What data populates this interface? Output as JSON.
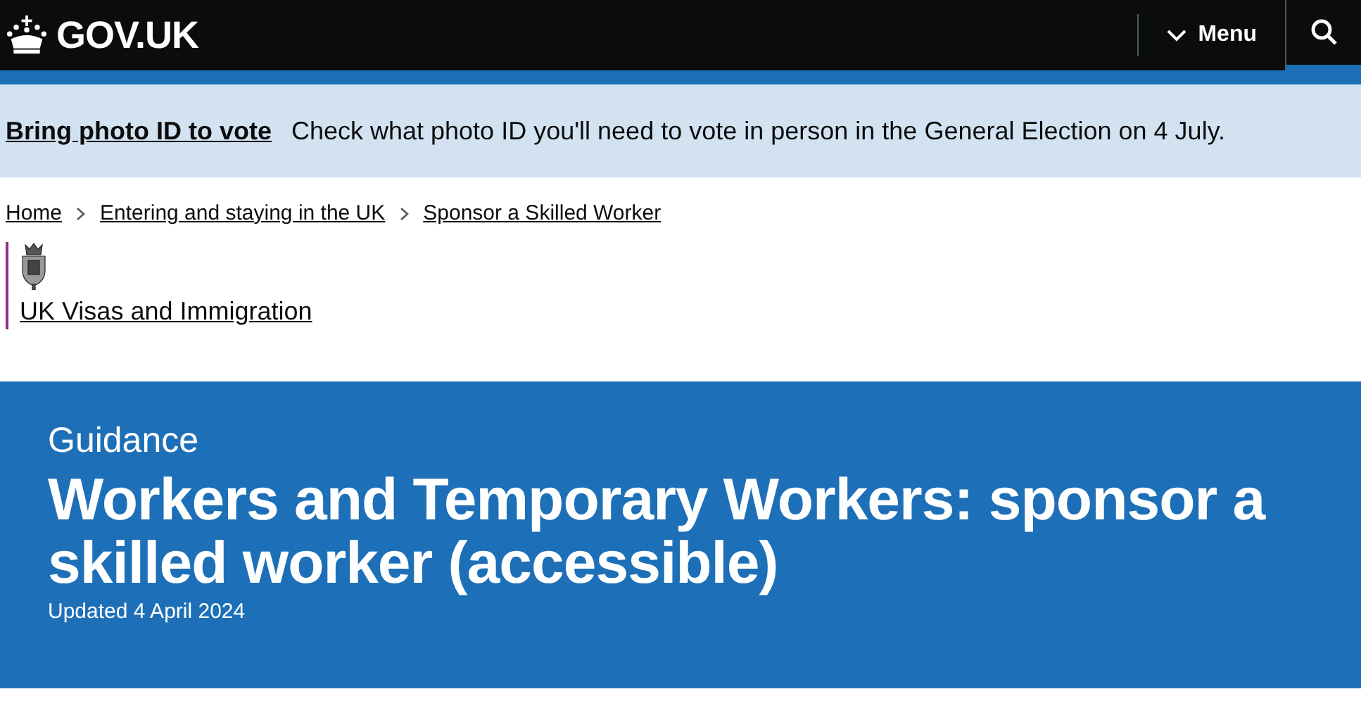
{
  "header": {
    "logo": "GOV.UK",
    "menu": {
      "label": "Menu",
      "expanded": false
    }
  },
  "banner": {
    "link": "Bring photo ID to vote",
    "text": "Check what photo ID you'll need to vote in person in the General Election on 4 July."
  },
  "breadcrumbs": [
    "Home",
    "Entering and staying in the UK",
    "Sponsor a Skilled Worker"
  ],
  "organisation": "UK Visas and Immigration",
  "hero": {
    "context": "Guidance",
    "title": "Workers and Temporary Workers: sponsor a skilled worker (accessible)",
    "updated": "Updated 4 April 2024"
  }
}
